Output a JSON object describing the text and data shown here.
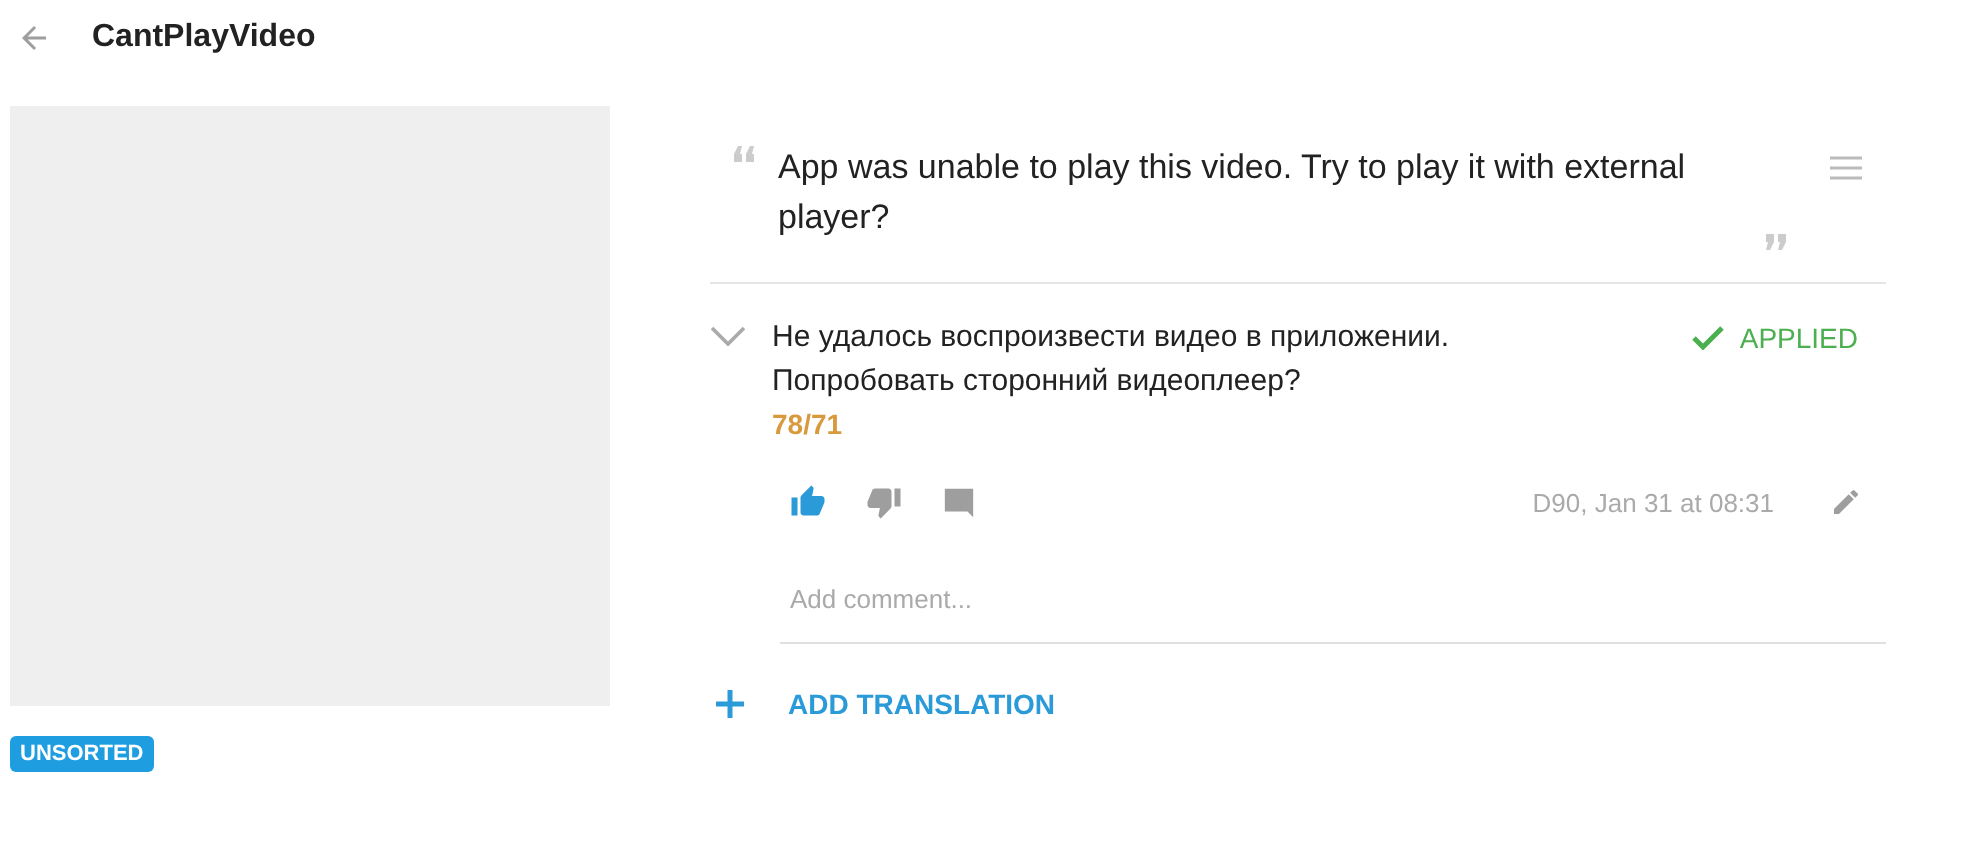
{
  "header": {
    "title": "CantPlayVideo"
  },
  "tag": {
    "label": "UNSORTED"
  },
  "source": {
    "text": "App was unable to play this video. Try to play it with external player?"
  },
  "translation": {
    "text": "Не удалось воспроизвести видео в приложении. Попробовать сторонний видеоплеер?",
    "expanded": false,
    "status": "APPLIED",
    "applied": true,
    "count": "78/71",
    "liked": true,
    "disliked": false,
    "meta": "D90, Jan 31 at 08:31"
  },
  "comment": {
    "placeholder": "Add comment..."
  },
  "add_button": {
    "label": "ADD TRANSLATION"
  }
}
